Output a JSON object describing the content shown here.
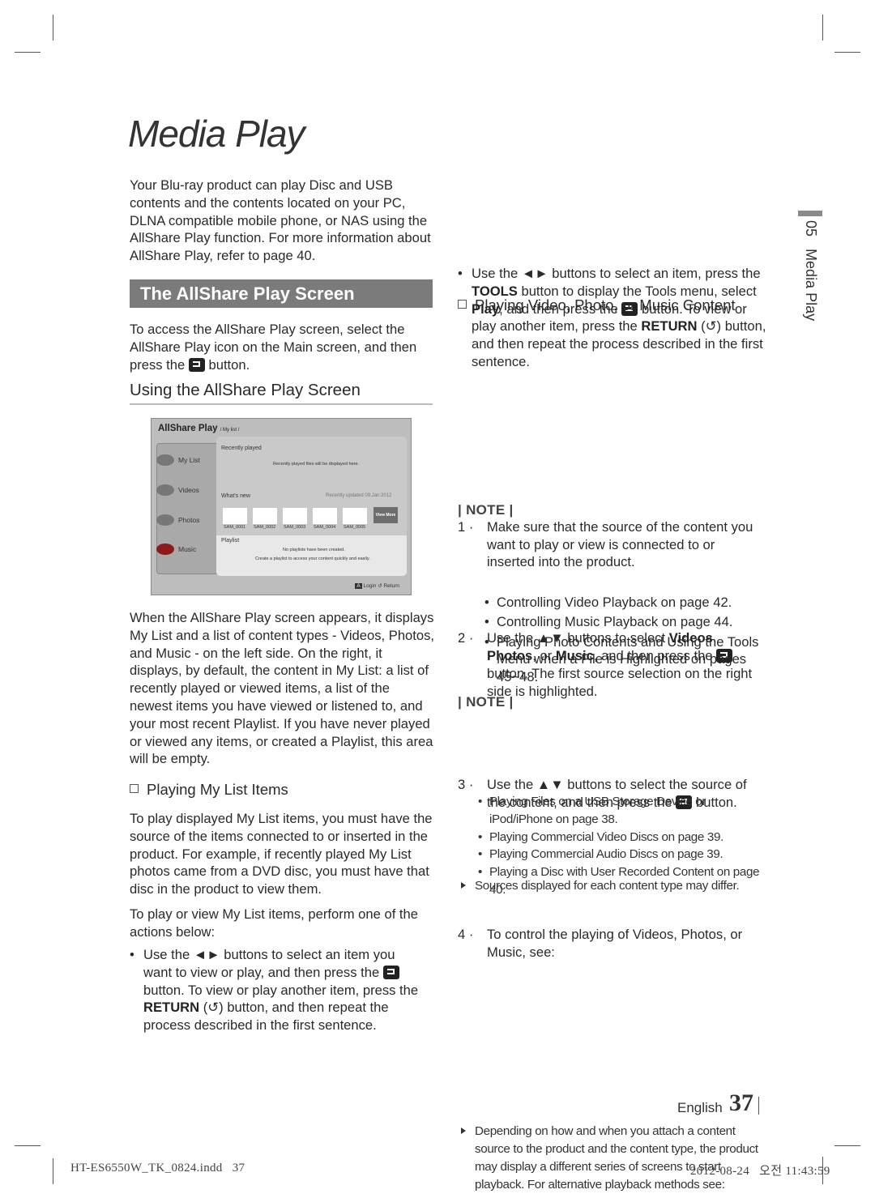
{
  "page_title": "Media Play",
  "left": {
    "intro": "Your Blu-ray product can play Disc and USB contents and the contents located on your PC, DLNA compatible mobile phone, or NAS using the AllShare Play function. For more information about AllShare Play, refer to page 40.",
    "section_header": "The AllShare Play Screen",
    "access_para": [
      "To access the AllShare Play screen, select the AllShare Play icon on the Main screen, and then press the ",
      {
        "icon": "enter-button"
      },
      " button."
    ],
    "subheading": "Using the AllShare Play Screen",
    "description": "When the AllShare Play screen appears, it displays My List and a list of content types - Videos, Photos, and Music - on the left side. On the right, it displays, by default, the content in My List: a list of recently played or viewed items, a list of the newest items you have viewed or listened to, and your most recent Playlist. If you have never played or viewed any items, or created a Playlist, this area will be empty.",
    "playing_mylist_heading": "Playing My List Items",
    "playing_mylist_p1": "To play displayed My List items, you must have the source of the items connected to or inserted in the product. For example, if recently played My List photos came from a DVD disc, you must have that disc in the product to view them.",
    "playing_mylist_p2": "To play or view My List items, perform one of the actions below:",
    "bullet": [
      "Use the ◄► buttons to select an item you want to view or play, and then press the ",
      {
        "icon": "enter-button"
      },
      " button. To view or play another item, press the ",
      {
        "b": "RETURN"
      },
      " (↺) button, and then repeat the process described in the first sentence."
    ]
  },
  "screen": {
    "title": "AllShare Play",
    "breadcrumb": "/ My list /",
    "menu": [
      "My List",
      "Videos",
      "Photos",
      "Music"
    ],
    "recently_played": "Recently played",
    "recently_played_empty": "Recently played files will be displayed here.",
    "whats_new": "What's new",
    "recently_updated": "Recently updated 09.Jan.2012",
    "thumbnails": [
      "SAM_0001",
      "SAM_0002",
      "SAM_0003",
      "SAM_0004",
      "SAM_0005"
    ],
    "view_more": "View More",
    "playlist": "Playlist",
    "playlist_empty": "No playlists have been created.",
    "playlist_hint": "Create a playlist to access your content quickly and easily.",
    "login": "Login",
    "return": "Return"
  },
  "right": {
    "bullet": [
      "Use the ◄► buttons to select an item, press the ",
      {
        "b": "TOOLS"
      },
      " button to display the Tools menu, select ",
      {
        "b": "Play"
      },
      ", and then press the ",
      {
        "icon": "enter-button"
      },
      " button. To view or play another item, press the ",
      {
        "b": "RETURN"
      },
      " (↺) button, and then repeat the process described in the first sentence."
    ],
    "heading": "Playing Video, Photo, or Music Content",
    "steps": [
      {
        "num": "1 ·",
        "segs": [
          "Make sure that the source of the content you want to play or view is connected to or inserted into the product."
        ]
      },
      {
        "num": "2 ·",
        "segs": [
          "Use the ▲▼ buttons to select ",
          {
            "b": "Videos"
          },
          ", ",
          {
            "b": "Photos"
          },
          ", or ",
          {
            "b": "Music"
          },
          ", and then press the ",
          {
            "icon": "enter-button"
          },
          " button. The first source selection on the right side is highlighted."
        ]
      },
      {
        "num": "3 ·",
        "segs": [
          "Use the ▲▼ buttons to select the source of the content, and then press the ",
          {
            "icon": "enter-button"
          },
          " button."
        ]
      },
      {
        "num": "4 ·",
        "segs": [
          "To control the playing of Videos, Photos, or Music, see:"
        ]
      }
    ],
    "note_label": "| NOTE |",
    "note1": "Sources displayed for each content type may differ.",
    "step4_refs": [
      "Controlling Video Playback on page 42.",
      "Controlling Music Playback on page 44.",
      "Playing Photo Contents and Using the Tools Menu when a File is Highlighted on pages 45~48."
    ],
    "note2": "Depending on how and when you attach a content source to the product and the content type, the product may display a different series of screens to start playback. For alternative playback methods see:",
    "note2_refs": [
      "Playing Files on a USB Storage Device or iPod/iPhone on page 38.",
      "Playing Commercial Video Discs on page 39.",
      "Playing Commercial Audio Discs on page 39.",
      "Playing a Disc with User Recorded Content on page 40."
    ]
  },
  "side_tab": {
    "number": "05",
    "label": "Media Play"
  },
  "footer": {
    "language": "English",
    "page_number": "37",
    "file_name": "HT-ES6550W_TK_0824.indd   37",
    "timestamp": "2012-08-24   오전 11:43:59"
  }
}
